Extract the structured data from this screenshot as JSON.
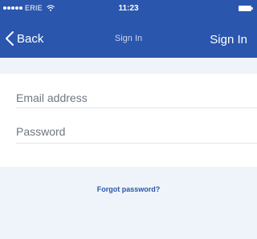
{
  "status_bar": {
    "carrier": "ERIE",
    "time": "11:23",
    "signal_icon": "signal-dots-icon",
    "wifi_icon": "wifi-icon",
    "battery_icon": "battery-icon"
  },
  "nav": {
    "back_label": "Back",
    "back_icon": "chevron-left-icon",
    "title": "Sign In",
    "action_label": "Sign In"
  },
  "form": {
    "email_placeholder": "Email address",
    "email_value": "",
    "password_placeholder": "Password",
    "password_value": ""
  },
  "forgot_password_label": "Forgot password?",
  "colors": {
    "header": "#2a56ad",
    "background": "#eef4f9",
    "card": "#ffffff",
    "link": "#2a56ad"
  }
}
